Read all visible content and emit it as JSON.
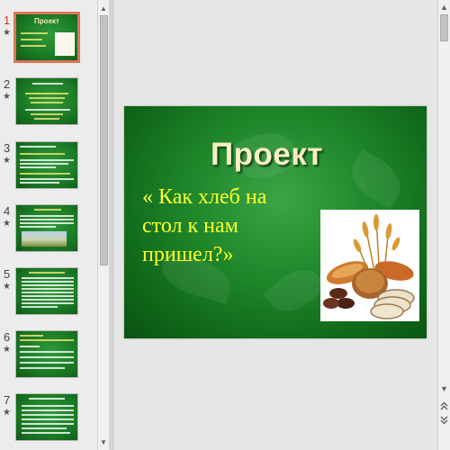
{
  "slide": {
    "title": "Проект",
    "subtitle_lines": [
      "« Как хлеб на",
      "стол к нам",
      "пришел?»"
    ]
  },
  "thumbnails": [
    {
      "number": "1",
      "title": "Проект",
      "selected": true
    },
    {
      "number": "2",
      "title": "",
      "selected": false
    },
    {
      "number": "3",
      "title": "",
      "selected": false
    },
    {
      "number": "4",
      "title": "",
      "selected": false
    },
    {
      "number": "5",
      "title": "",
      "selected": false
    },
    {
      "number": "6",
      "title": "",
      "selected": false
    },
    {
      "number": "7",
      "title": "",
      "selected": false
    }
  ],
  "icons": {
    "animation_marker": "star-icon",
    "scroll_up": "triangle-up-icon",
    "scroll_down": "triangle-down-icon",
    "prev_slide": "double-chevron-up-icon",
    "next_slide": "double-chevron-down-icon"
  },
  "colors": {
    "slide_bg": "#1d8428",
    "title": "#f7efc3",
    "subtitle": "#ffff2e",
    "selected_border": "#e0735a",
    "selected_number": "#c0392b"
  }
}
